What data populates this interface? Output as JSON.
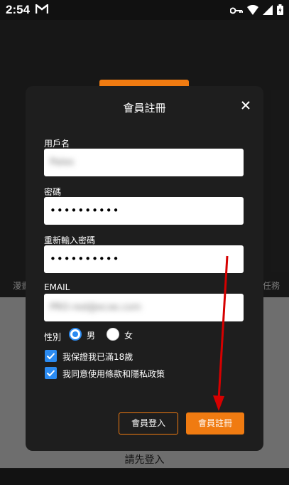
{
  "status_bar": {
    "time": "2:54"
  },
  "background": {
    "tab_left": "漫畫",
    "tab_right": "任務",
    "login_prompt": "請先登入"
  },
  "dialog": {
    "title": "會員註冊",
    "username": {
      "label": "用戶名",
      "value": "Palex"
    },
    "password": {
      "label": "密碼",
      "value": "••••••••••"
    },
    "password_confirm": {
      "label": "重新輸入密碼",
      "value": "••••••••••"
    },
    "email": {
      "label": "EMAIL",
      "value": "PRO-red@ecxe.com"
    },
    "gender": {
      "label": "性別",
      "male": "男",
      "female": "女",
      "selected": "男"
    },
    "age_check": {
      "label": "我保證我已滿18歲",
      "checked": true
    },
    "policy_check": {
      "label": "我同意使用條款和隱私政策",
      "checked": true
    },
    "login_button": "會員登入",
    "register_button": "會員註冊"
  },
  "colors": {
    "accent": "#f07b11",
    "checkbox": "#2b8bf2",
    "annotation_arrow": "#d60000"
  }
}
